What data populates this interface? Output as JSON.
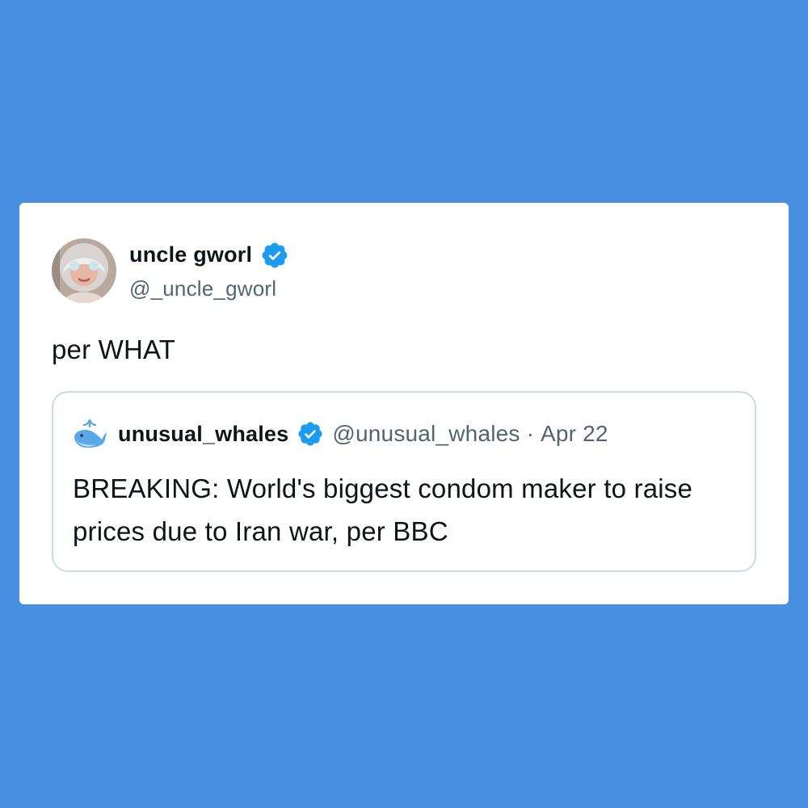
{
  "tweet": {
    "author": {
      "display_name": "uncle gworl",
      "handle": "@_uncle_gworl",
      "verified": true,
      "avatar_icon": "profile-photo"
    },
    "text": "per WHAT",
    "quoted_tweet": {
      "author": {
        "display_name": "unusual_whales",
        "handle": "@unusual_whales",
        "verified": true,
        "avatar_icon": "whale-emoji-icon"
      },
      "separator": "·",
      "date": "Apr 22",
      "text": "BREAKING: World's biggest condom maker to raise prices due to Iran war, per BBC"
    }
  },
  "colors": {
    "background": "#4a90e2",
    "card": "#ffffff",
    "text_primary": "#0f1419",
    "text_secondary": "#536471",
    "verified_blue": "#1d9bf0",
    "quote_border": "#cfd9de"
  }
}
